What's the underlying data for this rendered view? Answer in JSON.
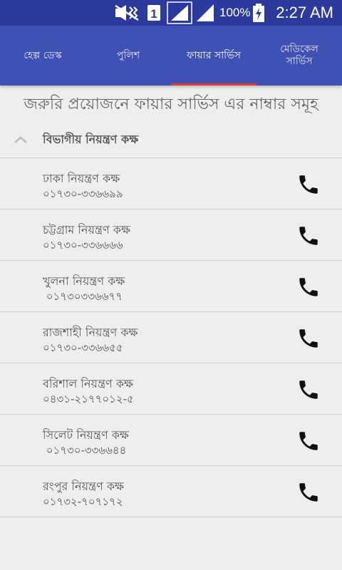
{
  "status_bar": {
    "battery_percent": "100%",
    "time": "2:27 AM",
    "sim_label": "1",
    "icons": [
      "mute-vibrate-icon",
      "sim-1-icon",
      "signal-icon",
      "signal-icon",
      "battery-charging-icon"
    ]
  },
  "tabs": [
    {
      "label": "হেল্প ডেস্ক",
      "active": false
    },
    {
      "label": "পুলিশ",
      "active": false
    },
    {
      "label": "ফায়ার সার্ভিস",
      "active": true
    },
    {
      "label": "মেডিকেল\nসার্ভিস",
      "active": false
    }
  ],
  "page_heading": "জরুরি প্রয়োজনে ফায়ার সার্ভিস এর নাম্বার সমূহ",
  "group": {
    "title": "বিভাগীয় নিয়ন্ত্রণ কক্ষ",
    "expanded": true
  },
  "contacts": [
    {
      "name": "ঢাকা নিয়ন্ত্রণ কক্ষ",
      "number": "০১৭৩০-৩৩৬৬৯৯"
    },
    {
      "name": "চট্টগ্রাম নিয়ন্ত্রণ কক্ষ",
      "number": "০১৭৩০-৩৩৬৬৬৬"
    },
    {
      "name": "খুলনা নিয়ন্ত্রণ কক্ষ",
      "number": " ০১৭৩০৩৩৬৬৭৭"
    },
    {
      "name": "রাজশাহী নিয়ন্ত্রণ কক্ষ",
      "number": "০১৭৩০-৩৩৬৬৫৫"
    },
    {
      "name": "বরিশাল নিয়ন্ত্রণ কক্ষ",
      "number": "০৪৩১-২১৭৭০১২-৫"
    },
    {
      "name": "সিলেট নিয়ন্ত্রণ কক্ষ",
      "number": " ০১৭৩০-৩৩৬৬৪৪"
    },
    {
      "name": "রংপুর নিয়ন্ত্রণ কক্ষ",
      "number": "০১৭৩২-৭০৭১৭২"
    }
  ],
  "colors": {
    "status_bar": "#2c3a9d",
    "toolbar": "#3f51b5",
    "tab_indicator": "#e53935",
    "background": "#eeeeee",
    "text": "#555555"
  }
}
